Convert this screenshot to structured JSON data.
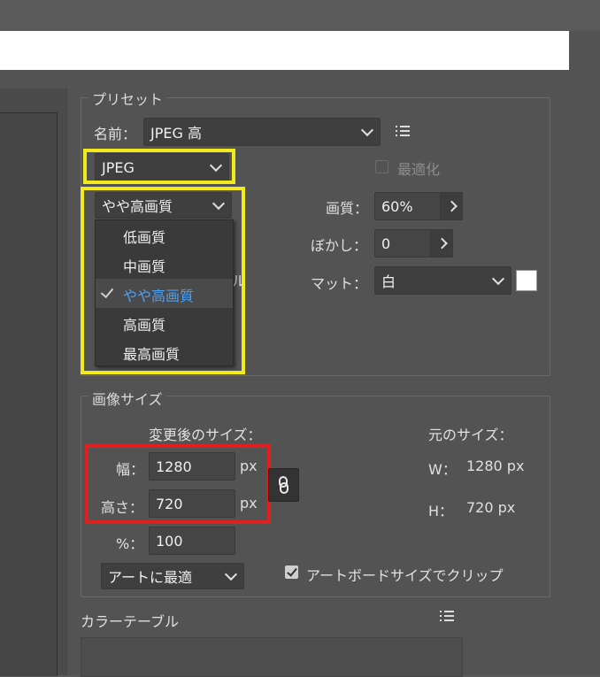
{
  "preset": {
    "legend": "プリセット",
    "name_label": "名前：",
    "name_value": "JPEG 高",
    "format_value": "JPEG",
    "optimize_label": "最適化",
    "quality_preset_value": "やや高画質",
    "quality_menu": [
      {
        "label": "低画質",
        "selected": false
      },
      {
        "label": "中画質",
        "selected": false
      },
      {
        "label": "やや高画質",
        "selected": true
      },
      {
        "label": "高画質",
        "selected": false
      },
      {
        "label": "最高画質",
        "selected": false
      }
    ],
    "quality_label": "画質：",
    "quality_value": "60%",
    "blur_label": "ぼかし：",
    "blur_value": "0",
    "matte_label": "マット：",
    "matte_value": "白",
    "partial_hidden_text": "ル"
  },
  "image_size": {
    "legend": "画像サイズ",
    "new_size_label": "変更後のサイズ：",
    "original_size_label": "元のサイズ：",
    "width_label": "幅：",
    "width_value": "1280",
    "height_label": "高さ：",
    "height_value": "720",
    "unit": "px",
    "percent_label": "%：",
    "percent_value": "100",
    "orig_w_label": "W：",
    "orig_w_value": "1280 px",
    "orig_h_label": "H：",
    "orig_h_value": "720 px",
    "fit_value": "アートに最適",
    "clip_label": "アートボードサイズでクリップ"
  },
  "color_table": {
    "legend": "カラーテーブル"
  },
  "colors": {
    "highlight_yellow": "#f2ea1a",
    "highlight_red": "#e02020",
    "selected_text": "#4ea0f2",
    "matte_swatch": "#ffffff"
  }
}
